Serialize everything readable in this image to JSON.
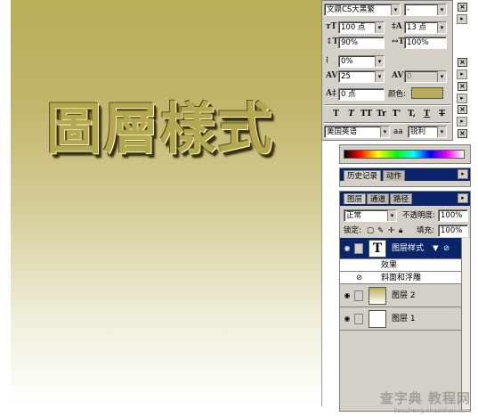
{
  "canvas": {
    "art_text": "圖層樣式",
    "text_color": "#b9ad59"
  },
  "character_panel": {
    "font_family": "文鼎CS大黑繁",
    "font_style": "-",
    "font_size": "100 点",
    "leading": "13 点",
    "vertical_scale": "90%",
    "horizontal_scale": "100%",
    "tsume": "0%",
    "tracking": "25",
    "kerning": "0",
    "baseline_shift": "0 点",
    "color_label": "颜色:",
    "color_value": "#b9ad59",
    "style_buttons": [
      "T",
      "T",
      "TT",
      "Tr",
      "T'",
      "T,",
      "T",
      "T"
    ],
    "language": "美国英语",
    "aa_label": "aa",
    "antialias": "锐利"
  },
  "history_panel": {
    "tabs": [
      "历史记录",
      "动作"
    ]
  },
  "layers_panel": {
    "tabs": [
      "图层",
      "通道",
      "路径"
    ],
    "blend_mode": "正常",
    "opacity_label": "不透明度:",
    "opacity_value": "100%",
    "lock_label": "锁定:",
    "fill_label": "填充:",
    "fill_value": "100%",
    "layers": [
      {
        "name": "图层样式",
        "type": "text",
        "selected": true,
        "thumb": "T"
      },
      {
        "name": "效果",
        "type": "effects-header"
      },
      {
        "name": "斜面和浮雕",
        "type": "effect"
      },
      {
        "name": "图层 2",
        "type": "gradient"
      },
      {
        "name": "图层 1",
        "type": "white"
      }
    ]
  },
  "watermark": {
    "main": "查字典 教程网",
    "sub": "jiaocheng.chazidian.com"
  }
}
